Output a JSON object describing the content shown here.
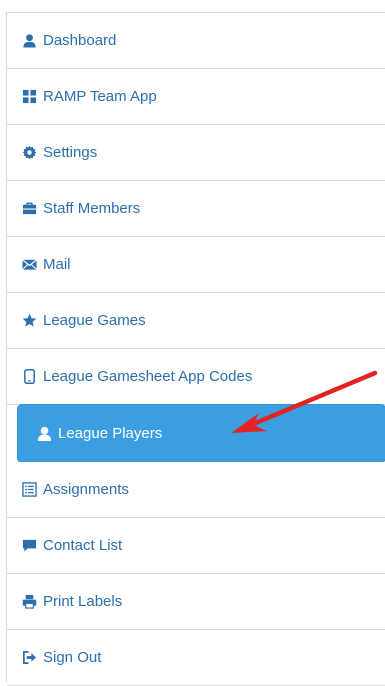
{
  "menu": {
    "items": [
      {
        "label": "Dashboard",
        "icon": "user-icon"
      },
      {
        "label": "RAMP Team App",
        "icon": "grid-icon"
      },
      {
        "label": "Settings",
        "icon": "gear-icon"
      },
      {
        "label": "Staff Members",
        "icon": "briefcase-icon"
      },
      {
        "label": "Mail",
        "icon": "envelope-icon"
      },
      {
        "label": "League Games",
        "icon": "star-icon"
      },
      {
        "label": "League Gamesheet App Codes",
        "icon": "phone-icon"
      },
      {
        "label": "League Players",
        "icon": "user-icon",
        "active": true
      },
      {
        "label": "Assignments",
        "icon": "list-icon"
      },
      {
        "label": "Contact List",
        "icon": "comment-icon"
      },
      {
        "label": "Print Labels",
        "icon": "printer-icon"
      },
      {
        "label": "Sign Out",
        "icon": "sign-out-icon"
      }
    ]
  },
  "colors": {
    "link": "#2b6fae",
    "active_bg": "#3a9ee0",
    "arrow": "#e32222"
  }
}
